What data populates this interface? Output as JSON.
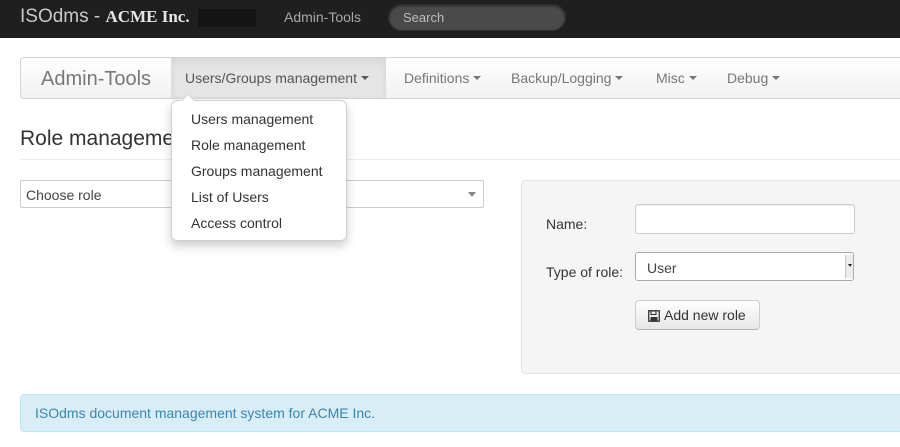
{
  "topbar": {
    "brand_text": "ISOdms - ",
    "brand_company": "ACME Inc.",
    "admin_tools_link": "Admin-Tools",
    "search_placeholder": "Search",
    "background_color": "#1f1f1f"
  },
  "subnav": {
    "brand": "Admin-Tools",
    "items": [
      {
        "label": "Users/Groups management",
        "active": true
      },
      {
        "label": "Definitions",
        "active": false
      },
      {
        "label": "Backup/Logging",
        "active": false
      },
      {
        "label": "Misc",
        "active": false
      },
      {
        "label": "Debug",
        "active": false
      }
    ]
  },
  "dropdown": {
    "items": [
      "Users management",
      "Role management",
      "Groups management",
      "List of Users",
      "Access control"
    ]
  },
  "page": {
    "title": "Role management",
    "choose_role": "Choose role"
  },
  "form": {
    "name_label": "Name:",
    "name_value": "",
    "type_label": "Type of role:",
    "type_selected": "User",
    "add_button": "Add new role",
    "add_button_icon": "floppy-disk-icon"
  },
  "footer": {
    "text": "ISOdms document management system for ACME Inc.",
    "background_color": "#d9edf7",
    "text_color": "#3a87ad"
  }
}
